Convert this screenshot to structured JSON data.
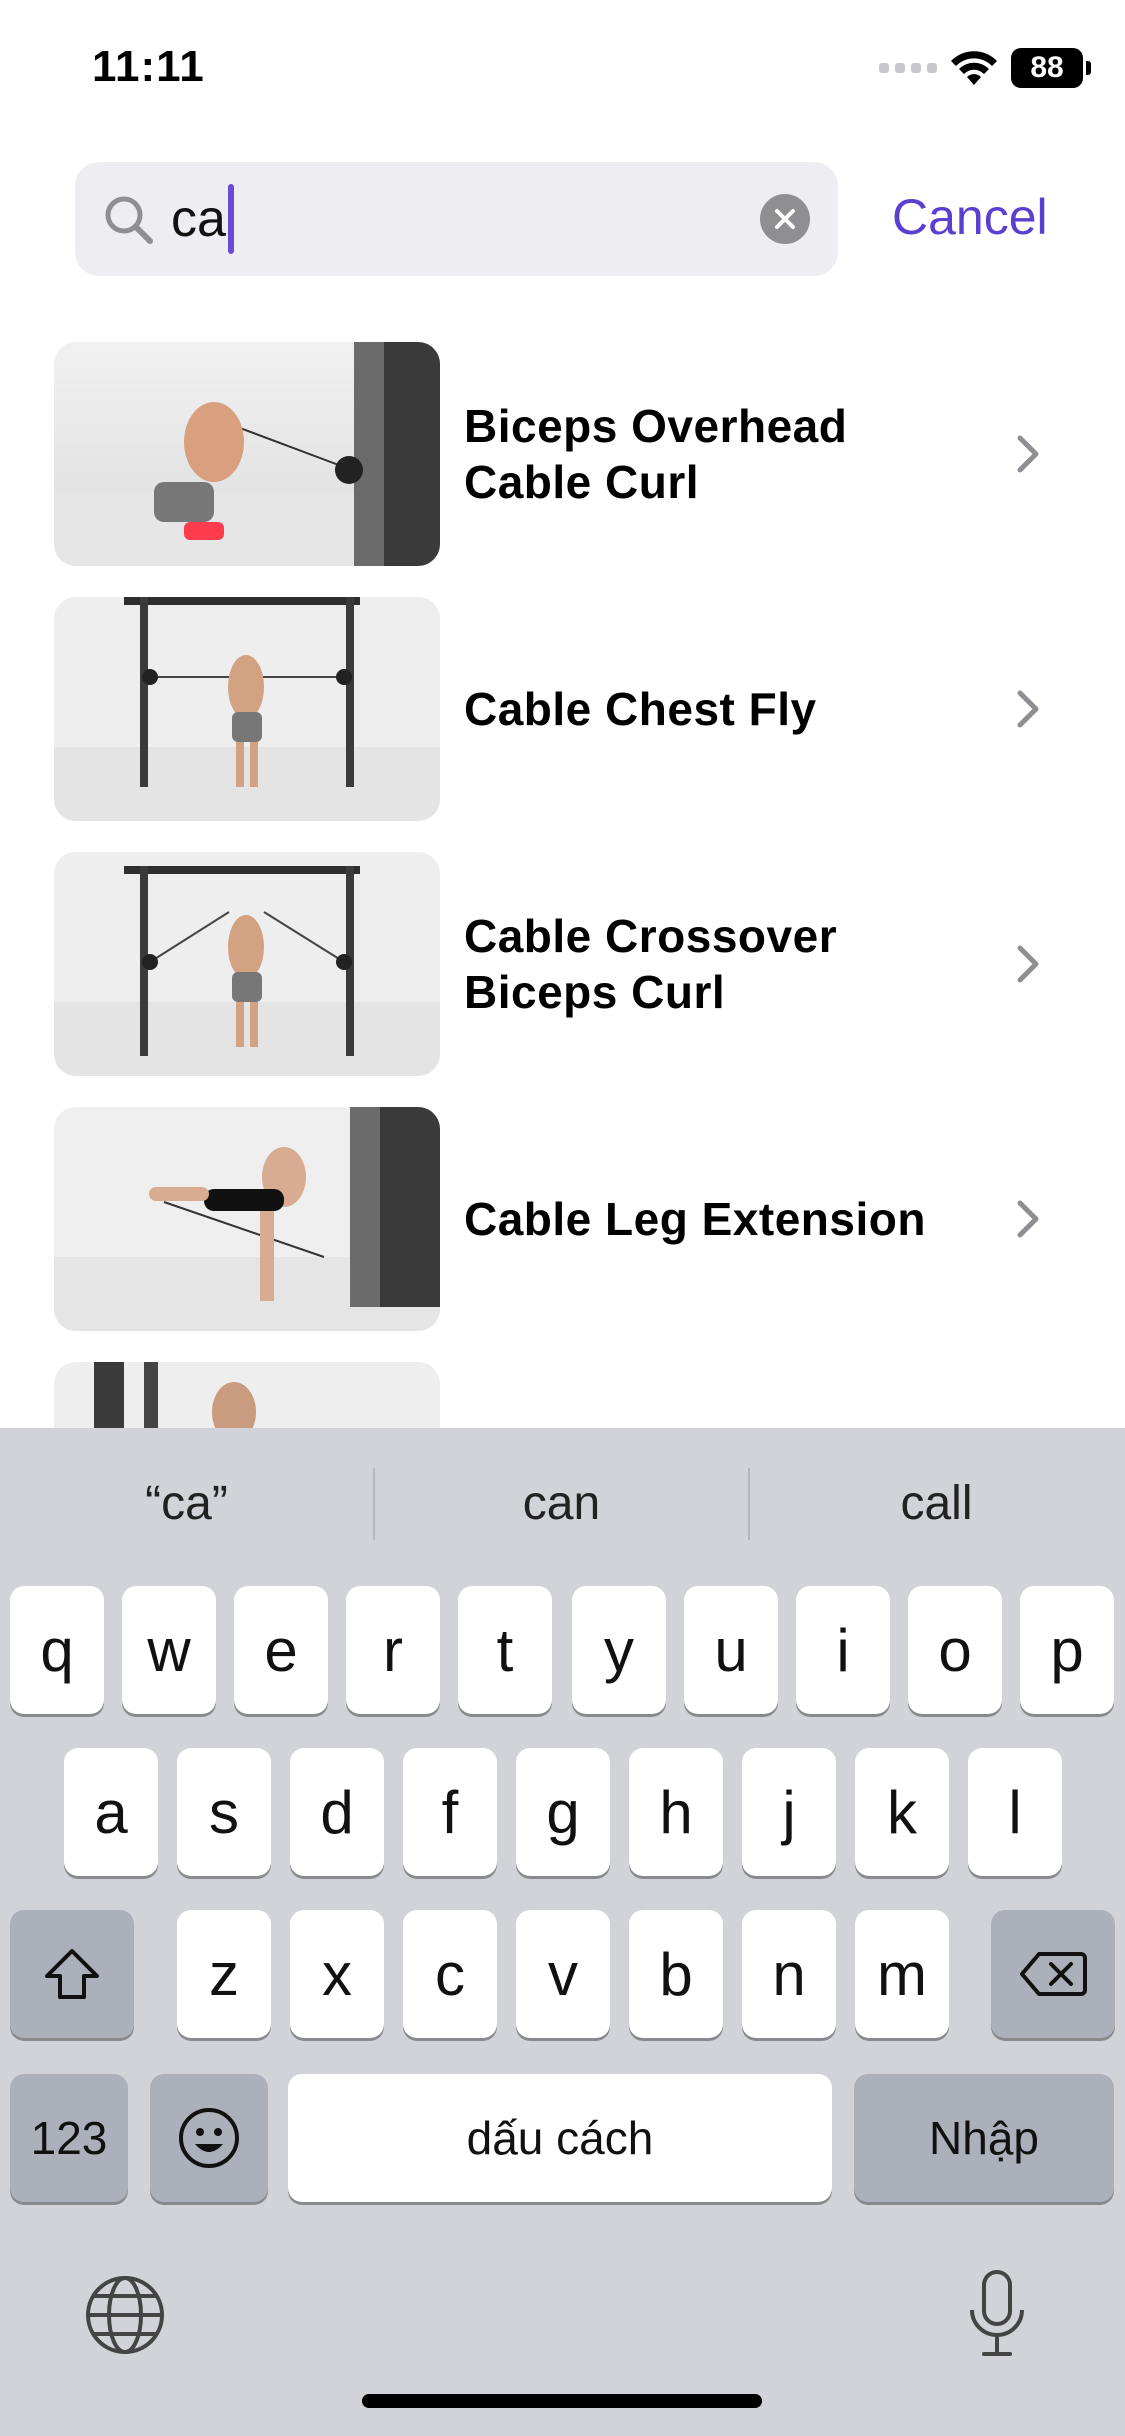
{
  "status_bar": {
    "time": "11:11",
    "battery": "88"
  },
  "search": {
    "query": "ca",
    "cancel_label": "Cancel"
  },
  "results": [
    {
      "title": "Biceps Overhead Cable Curl"
    },
    {
      "title": "Cable Chest Fly"
    },
    {
      "title": "Cable Crossover Biceps Curl"
    },
    {
      "title": "Cable Leg Extension"
    }
  ],
  "keyboard": {
    "suggestions": [
      "“ca”",
      "can",
      "call"
    ],
    "row1": [
      "q",
      "w",
      "e",
      "r",
      "t",
      "y",
      "u",
      "i",
      "o",
      "p"
    ],
    "row2": [
      "a",
      "s",
      "d",
      "f",
      "g",
      "h",
      "j",
      "k",
      "l"
    ],
    "row3": [
      "z",
      "x",
      "c",
      "v",
      "b",
      "n",
      "m"
    ],
    "numbers_label": "123",
    "space_label": "dấu cách",
    "return_label": "Nhập"
  }
}
